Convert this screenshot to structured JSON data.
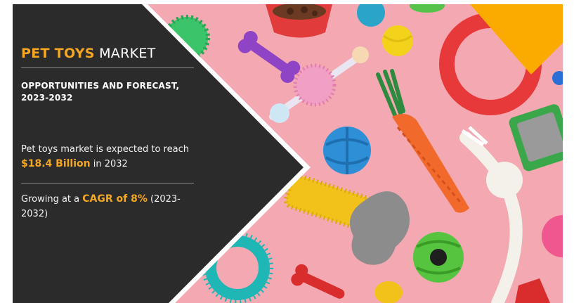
{
  "infographic": {
    "title_accent": "PET TOYS",
    "title_rest": "MARKET",
    "subtitle": "OPPORTUNITIES AND FORECAST, 2023-2032",
    "reach_prefix": "Pet toys market is expected to reach",
    "reach_value": "$18.4 Billion",
    "reach_suffix": "in 2032",
    "growth_prefix": "Growing at a",
    "growth_value": "CAGR of 8%",
    "growth_suffix": "(2023-2032)"
  },
  "colors": {
    "panel": "#2b2b2b",
    "accent": "#f5a623",
    "background_pink": "#f4a8b2"
  },
  "photo_items": [
    "green-spiky-ball",
    "purple-bone",
    "pink-rope-dumbbell",
    "red-food-bowl",
    "blue-ball",
    "yellow-tennis-ball",
    "red-ring",
    "green-carrot-rope",
    "orange-carrot",
    "blue-treat-ball",
    "white-rope-knot",
    "green-brush",
    "yellow-spiky-stick",
    "grey-plush-bone",
    "green-treat-ball",
    "teal-spiky-ring",
    "red-small-bone",
    "yellow-duck",
    "pink-ball",
    "red-toy"
  ]
}
